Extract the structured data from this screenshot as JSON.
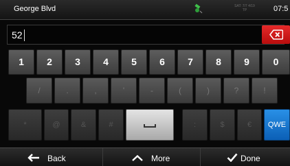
{
  "status": {
    "title": "George Blvd",
    "gps_info": "SAT: 7/7 4/19 TP",
    "time": "07:5"
  },
  "input": {
    "value": "52"
  },
  "keys": {
    "row1": [
      "1",
      "2",
      "3",
      "4",
      "5",
      "6",
      "7",
      "8",
      "9",
      "0"
    ],
    "row2": [
      "/",
      ".",
      ",",
      "'",
      "-",
      "(",
      ")",
      "?",
      "!"
    ],
    "row3": [
      "*",
      "@",
      "&",
      "#",
      "",
      ":",
      "$",
      "€",
      "QWE"
    ]
  },
  "bottom": {
    "back_label": "Back",
    "more_label": "More",
    "done_label": "Done"
  },
  "colors": {
    "accent_blue": "#1a73d0",
    "delete_red": "#d61c1c",
    "key_gray": "#4b4b4b"
  }
}
